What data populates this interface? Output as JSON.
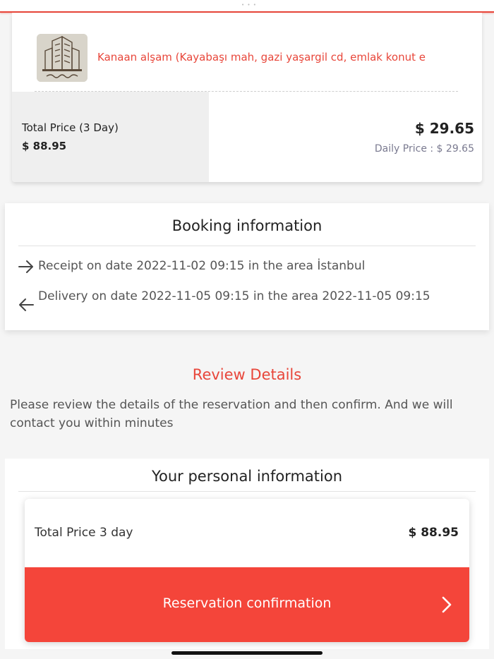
{
  "status_bar": {
    "left_text": "",
    "right_text": ""
  },
  "company": {
    "name": "Kanaan alşam   (Kayabaşı mah, gazi yaşargil cd, emlak konut e",
    "logo_icon": "building-logo-icon"
  },
  "pricing": {
    "total_label": "Total Price (3 Day)",
    "total_value": "$ 88.95",
    "daily_big": "$ 29.65",
    "daily_small": "Daily Price : $ 29.65"
  },
  "booking": {
    "title": "Booking information",
    "receipt_text": "Receipt on date 2022-11-02 09:15 in the area İstanbul",
    "delivery_text": "Delivery on date 2022-11-05 09:15 in the area 2022-11-05 09:15",
    "receipt_icon": "arrow-right-icon",
    "delivery_icon": "arrow-left-icon"
  },
  "review": {
    "title": "Review Details",
    "text": "Please review the details of the reservation and then confirm. And we will contact you within minutes"
  },
  "personal": {
    "title": "Your personal information"
  },
  "sheet": {
    "total_label": "Total Price 3 day",
    "total_value": "$ 88.95",
    "confirm_label": "Reservation confirmation",
    "confirm_icon": "chevron-right-icon"
  },
  "colors": {
    "accent": "#e8463a",
    "button": "#f4453a"
  }
}
